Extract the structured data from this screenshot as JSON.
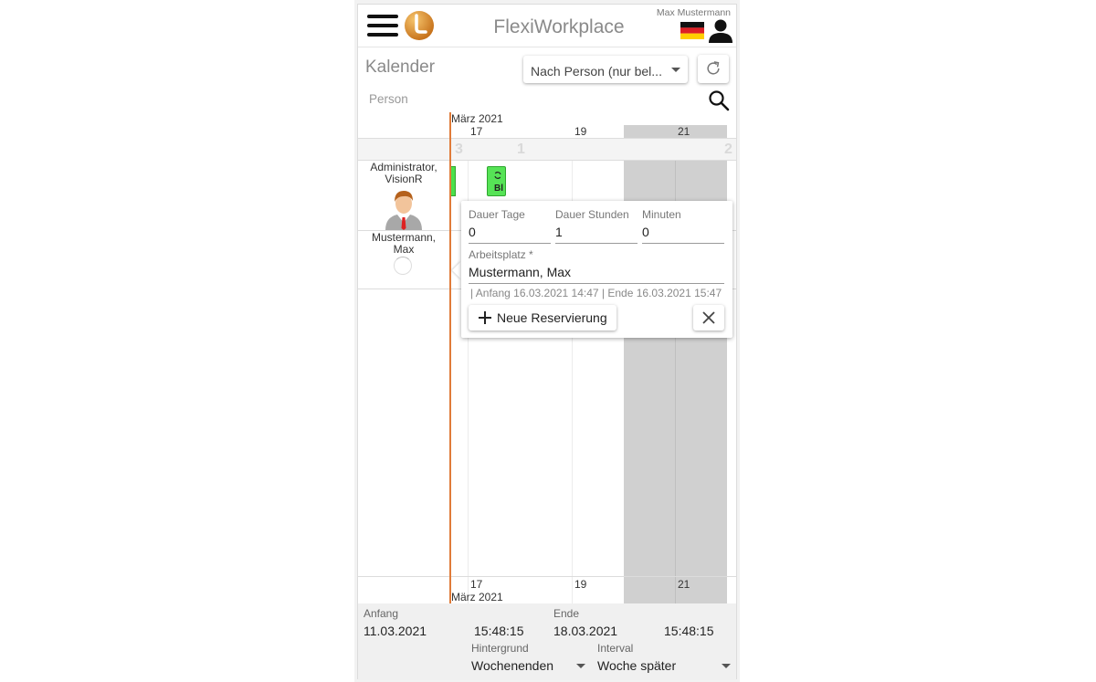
{
  "header": {
    "app_title": "FlexiWorkplace",
    "username": "Max Mustermann",
    "icons": [
      "menu-icon",
      "app-logo",
      "german-flag-icon",
      "user-icon"
    ]
  },
  "toolbar": {
    "page_title": "Kalender",
    "view_select": "Nach Person (nur bel...",
    "person_label": "Person"
  },
  "calendar": {
    "month_top": "März 2021",
    "month_bottom": "März 2021",
    "days": [
      "17",
      "19",
      "21"
    ],
    "band_numbers": [
      "3",
      "1",
      "2"
    ],
    "resources": [
      {
        "name": "Administrator, VisionR"
      },
      {
        "name": "Mustermann, Max"
      }
    ],
    "booking_label": "Bl"
  },
  "popup": {
    "days_label": "Dauer Tage",
    "days_value": "0",
    "hours_label": "Dauer Stunden",
    "hours_value": "1",
    "minutes_label": "Minuten",
    "minutes_value": "0",
    "workplace_label": "Arbeitsplatz *",
    "workplace_value": "Mustermann, Max",
    "info": "| Anfang 16.03.2021 14:47 | Ende 16.03.2021 15:47",
    "new_button": "Neue Reservierung"
  },
  "bottom": {
    "start_label": "Anfang",
    "start_date": "11.03.2021",
    "start_time": "15:48:15",
    "end_label": "Ende",
    "end_date": "18.03.2021",
    "end_time": "15:48:15",
    "background_label": "Hintergrund",
    "background_value": "Wochenenden",
    "interval_label": "Interval",
    "interval_value": "Woche später"
  }
}
